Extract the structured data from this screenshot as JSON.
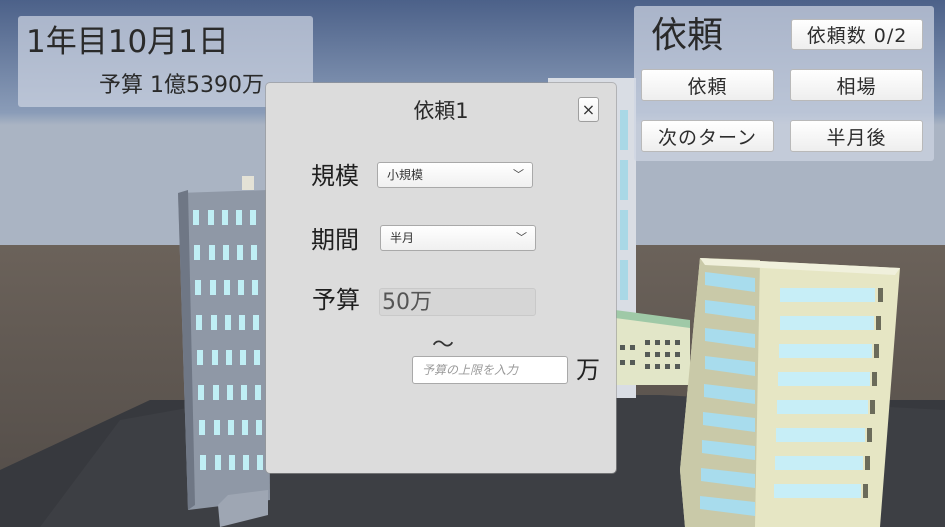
{
  "hud": {
    "date": "1年目10月1日",
    "budget": "予算 1億5390万"
  },
  "menu": {
    "title": "依頼",
    "request_count": "依頼数 0/2",
    "request_button": "依頼",
    "market_button": "相場",
    "next_turn_button": "次のターン",
    "half_month_button": "半月後"
  },
  "dialog": {
    "title": "依頼1",
    "close": "×",
    "scale_label": "規模",
    "scale_value": "小規模",
    "period_label": "期間",
    "period_value": "半月",
    "budget_label": "予算",
    "budget_value": "50万",
    "range_sep": "～",
    "upper_placeholder": "予算の上限を入力",
    "unit": "万"
  },
  "colors": {
    "sky_top": "#5a6e92",
    "ground": "#3b3d42",
    "panel": "#cdd4e2",
    "dialog": "#dcdcdc"
  }
}
